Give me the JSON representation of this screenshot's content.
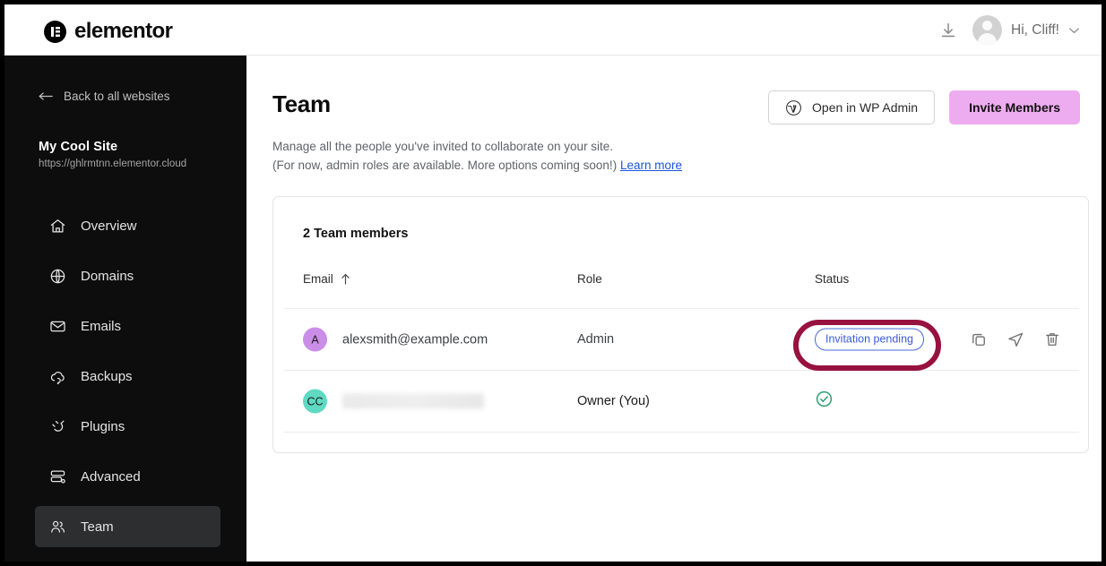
{
  "header": {
    "brand": "elementor",
    "brand_icon": "elementor-logo-icon",
    "download_icon": "download-icon",
    "greeting": "Hi, Cliff!",
    "chevron_icon": "chevron-down-icon"
  },
  "sidebar": {
    "back_label": "Back to all websites",
    "back_icon": "arrow-left-icon",
    "site_name": "My Cool Site",
    "site_url": "https://ghlrmtnn.elementor.cloud",
    "items": [
      {
        "label": "Overview",
        "icon": "home-icon",
        "active": false
      },
      {
        "label": "Domains",
        "icon": "globe-icon",
        "active": false
      },
      {
        "label": "Emails",
        "icon": "envelope-icon",
        "active": false
      },
      {
        "label": "Backups",
        "icon": "cloud-restore-icon",
        "active": false
      },
      {
        "label": "Plugins",
        "icon": "plug-icon",
        "active": false
      },
      {
        "label": "Advanced",
        "icon": "server-settings-icon",
        "active": false
      },
      {
        "label": "Team",
        "icon": "users-icon",
        "active": true
      }
    ]
  },
  "main": {
    "title": "Team",
    "description_line1": "Manage all the people you've invited to collaborate on your site.",
    "description_line2": "(For now, admin roles are available. More options coming soon!)",
    "learn_more": "Learn more",
    "wp_admin_button": "Open in WP Admin",
    "wp_admin_icon": "wordpress-icon",
    "invite_button": "Invite Members",
    "invite_button_color": "#eeacf0"
  },
  "table": {
    "card_title": "2 Team members",
    "columns": {
      "email": "Email",
      "role": "Role",
      "status": "Status"
    },
    "sort_icon": "arrow-up-icon",
    "rows": [
      {
        "avatar_initials": "A",
        "avatar_color": "#cb8ee8",
        "email": "alexsmith@example.com",
        "role": "Admin",
        "status_label": "Invitation pending",
        "status_type": "badge",
        "status_color": "#3b5bd8",
        "actions": [
          "copy-icon",
          "send-icon",
          "trash-icon"
        ]
      },
      {
        "avatar_initials": "CC",
        "avatar_color": "#5fd9c2",
        "email": "",
        "email_redacted": true,
        "role": "Owner (You)",
        "status_label": "",
        "status_type": "check",
        "status_color": "#2e9e6b",
        "actions": []
      }
    ]
  },
  "annotation": {
    "target": "Invitation pending",
    "shape": "ellipse-highlight",
    "color": "#97123f"
  }
}
